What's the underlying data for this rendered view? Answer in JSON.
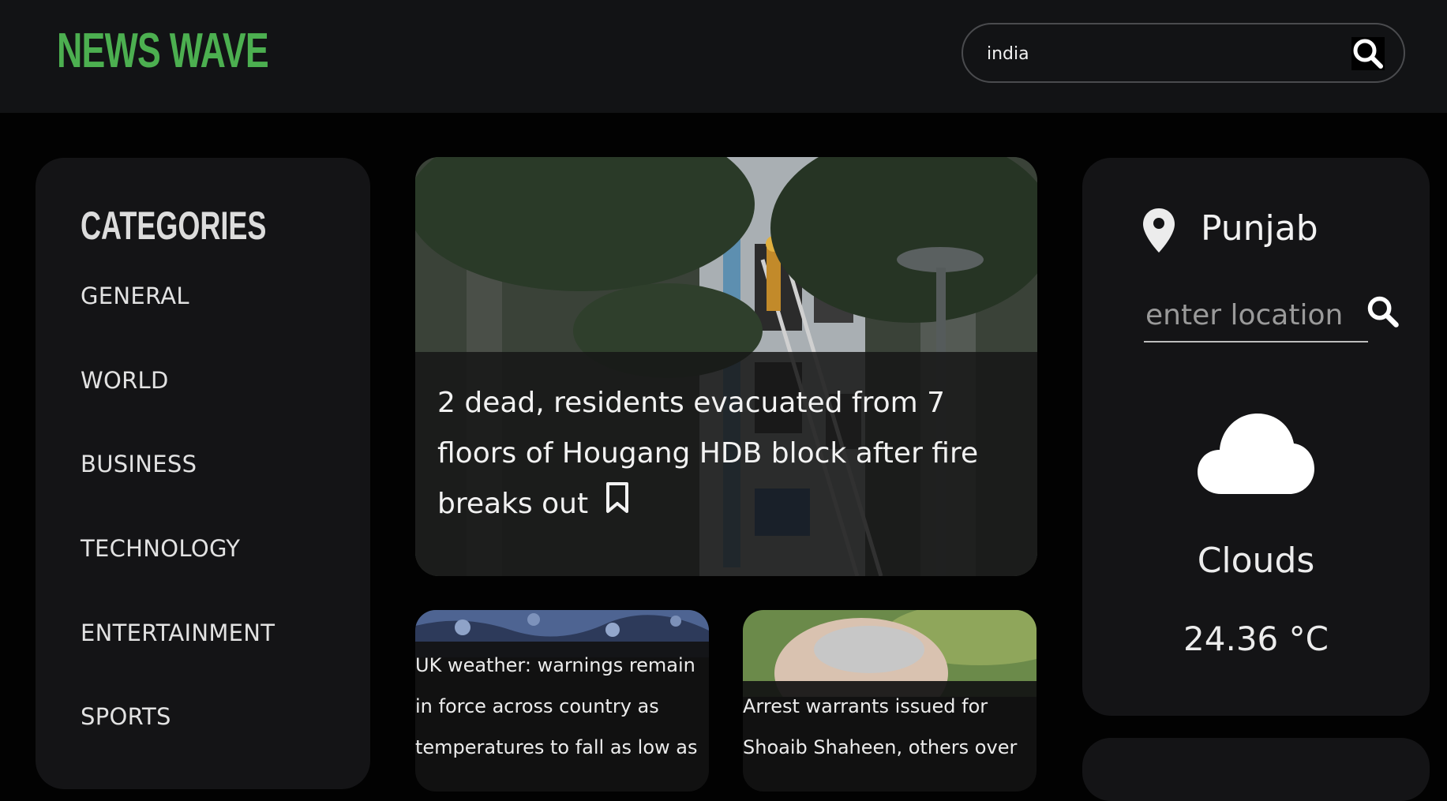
{
  "app": {
    "logo": "NEWS WAVE",
    "brand_color": "#4caf50"
  },
  "search": {
    "value": "india",
    "icon": "search-icon"
  },
  "sidebar": {
    "title": "CATEGORIES",
    "items": [
      {
        "label": "GENERAL"
      },
      {
        "label": "WORLD"
      },
      {
        "label": "BUSINESS"
      },
      {
        "label": "TECHNOLOGY"
      },
      {
        "label": "ENTERTAINMENT"
      },
      {
        "label": "SPORTS"
      }
    ]
  },
  "featured": {
    "headline": "2 dead, residents evacuated from 7 floors of Hougang HDB block after fire breaks out",
    "bookmark_icon": "bookmark-icon"
  },
  "cards": [
    {
      "title": "UK weather: warnings remain in force across country as temperatures to fall as low as"
    },
    {
      "title": "Arrest warrants issued for Shoaib Shaheen, others over"
    }
  ],
  "weather": {
    "location": "Punjab",
    "location_placeholder": "enter location",
    "condition": "Clouds",
    "temperature": "24.36 °C",
    "condition_icon": "cloud-icon"
  }
}
